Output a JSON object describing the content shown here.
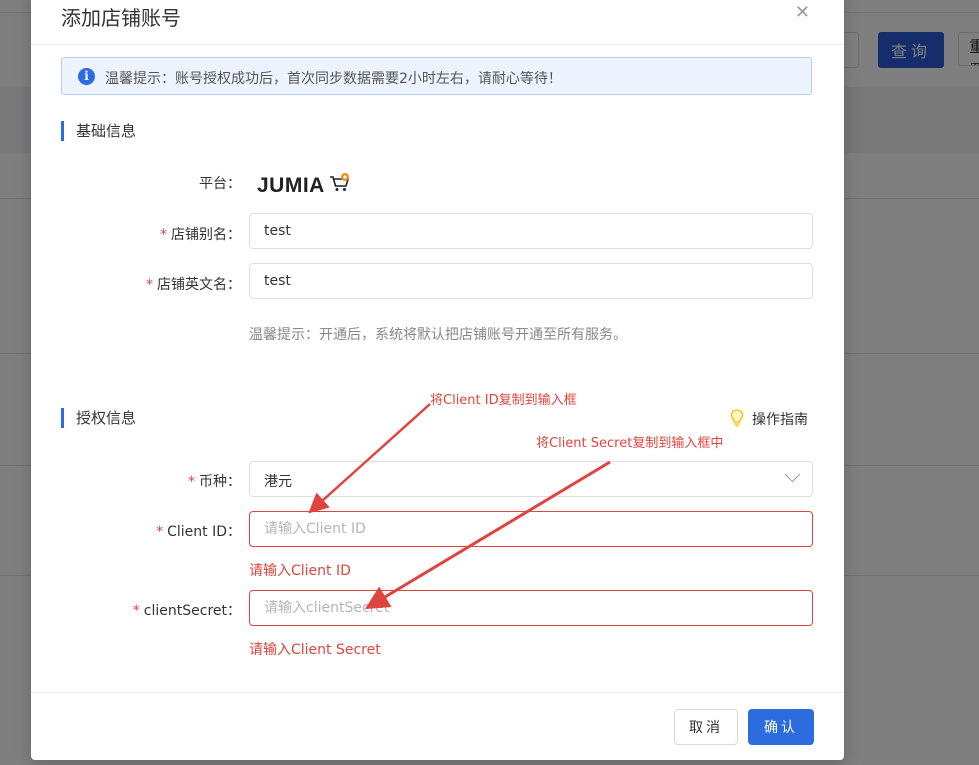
{
  "background": {
    "query_button": "查询",
    "reset_button": "重置"
  },
  "modal": {
    "title": "添加店铺账号",
    "close_icon": "close-icon",
    "alert_text": "温馨提示：账号授权成功后，首次同步数据需要2小时左右，请耐心等待！",
    "basic_section": "基础信息",
    "platform_label": "平台：",
    "platform_logo_text": "JUMIA",
    "store_alias_label": "店铺别名：",
    "store_alias_value": "test",
    "store_en_label": "店铺英文名：",
    "store_en_value": "test",
    "basic_hint": "温馨提示：开通后，系统将默认把店铺账号开通至所有服务。",
    "auth_section": "授权信息",
    "guide_label": "操作指南",
    "currency_label": "币种：",
    "currency_value": "港元",
    "client_id_label": "Client ID：",
    "client_id_placeholder": "请输入Client ID",
    "client_id_error": "请输入Client ID",
    "client_secret_label": "clientSecret：",
    "client_secret_placeholder": "请输入clientSecret",
    "client_secret_error": "请输入Client Secret",
    "cancel_button": "取消",
    "ok_button": "确认"
  },
  "annotations": {
    "client_id_note": "将Client ID复制到输入框",
    "client_secret_note": "将Client Secret复制到输入框中",
    "color": "#e0443f"
  },
  "colors": {
    "primary": "#2d6cdf",
    "error": "#e0443f"
  }
}
